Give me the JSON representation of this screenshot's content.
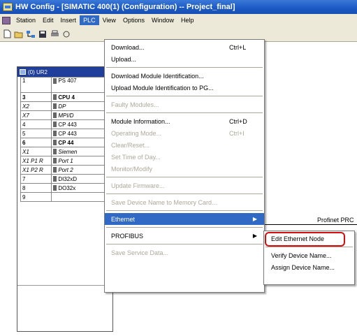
{
  "window": {
    "title": "HW Config - [SIMATIC 400(1) (Configuration) -- Project_final]"
  },
  "menubar": {
    "items": [
      "Station",
      "Edit",
      "Insert",
      "PLC",
      "View",
      "Options",
      "Window",
      "Help"
    ],
    "active": "PLC"
  },
  "toolbar": {
    "icons": [
      "new-icon",
      "open-icon",
      "network-icon",
      "save-icon",
      "print-icon",
      "compile-icon"
    ]
  },
  "rack": {
    "title": "(0) UR2",
    "rows": [
      {
        "slot": "1",
        "module": "PS 407",
        "style": "big"
      },
      {
        "slot": "3",
        "module": "CPU 4",
        "style": "bold"
      },
      {
        "slot": "X2",
        "module": "DP",
        "style": "italic"
      },
      {
        "slot": "X7",
        "module": "MPI/D",
        "style": "italic"
      },
      {
        "slot": "4",
        "module": "CP 443",
        "style": ""
      },
      {
        "slot": "5",
        "module": "CP 443",
        "style": ""
      },
      {
        "slot": "6",
        "module": "CP 44",
        "style": "bold"
      },
      {
        "slot": "X1",
        "module": "Siemen",
        "style": "italic"
      },
      {
        "slot": "X1 P1 R",
        "module": "Port 1",
        "style": "italic"
      },
      {
        "slot": "X1 P2 R",
        "module": "Port 2",
        "style": "italic"
      },
      {
        "slot": "7",
        "module": "DI32xD",
        "style": ""
      },
      {
        "slot": "8",
        "module": "DO32x",
        "style": ""
      },
      {
        "slot": "9",
        "module": "",
        "style": ""
      }
    ]
  },
  "network": {
    "label": "Profinet PRC"
  },
  "plc_menu": {
    "items": [
      {
        "label": "Download...",
        "shortcut": "Ctrl+L",
        "enabled": true
      },
      {
        "label": "Upload...",
        "shortcut": "",
        "enabled": true
      },
      {
        "sep": true
      },
      {
        "label": "Download Module Identification...",
        "shortcut": "",
        "enabled": true
      },
      {
        "label": "Upload Module Identification to PG...",
        "shortcut": "",
        "enabled": true
      },
      {
        "sep": true
      },
      {
        "label": "Faulty Modules...",
        "shortcut": "",
        "enabled": false
      },
      {
        "sep": true
      },
      {
        "label": "Module Information...",
        "shortcut": "Ctrl+D",
        "enabled": true
      },
      {
        "label": "Operating Mode...",
        "shortcut": "Ctrl+I",
        "enabled": false
      },
      {
        "label": "Clear/Reset...",
        "shortcut": "",
        "enabled": false
      },
      {
        "label": "Set Time of Day...",
        "shortcut": "",
        "enabled": false
      },
      {
        "label": "Monitor/Modify",
        "shortcut": "",
        "enabled": false
      },
      {
        "sep": true
      },
      {
        "label": "Update Firmware...",
        "shortcut": "",
        "enabled": false
      },
      {
        "sep": true
      },
      {
        "label": "Save Device Name to Memory Card...",
        "shortcut": "",
        "enabled": false
      },
      {
        "sep": true
      },
      {
        "label": "Ethernet",
        "shortcut": "",
        "enabled": true,
        "submenu": true,
        "highlighted": true
      },
      {
        "sep": true
      },
      {
        "label": "PROFIBUS",
        "shortcut": "",
        "enabled": true,
        "submenu": true
      },
      {
        "sep": true
      },
      {
        "label": "Save Service Data...",
        "shortcut": "",
        "enabled": false
      }
    ]
  },
  "ethernet_submenu": {
    "items": [
      {
        "label": "Edit Ethernet Node",
        "circled": true
      },
      {
        "sep": true
      },
      {
        "label": "Verify Device Name..."
      },
      {
        "label": "Assign Device Name..."
      }
    ]
  },
  "colors": {
    "titlebar": "#1b58c4",
    "highlight": "#316ac5",
    "circle": "#d01010",
    "menu_bg": "#ece9d8"
  }
}
